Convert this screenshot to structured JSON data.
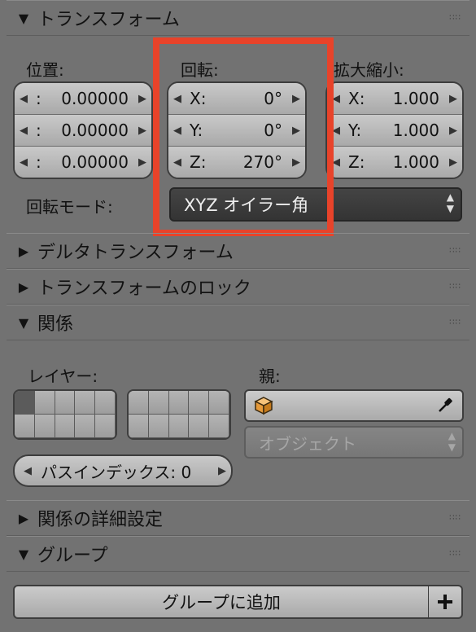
{
  "transform": {
    "header": "トランスフォーム",
    "location": {
      "label": "位置:",
      "rows": [
        {
          "axis": ":",
          "value": "0.00000"
        },
        {
          "axis": ":",
          "value": "0.00000"
        },
        {
          "axis": ":",
          "value": "0.00000"
        }
      ]
    },
    "rotation": {
      "label": "回転:",
      "rows": [
        {
          "axis": "X:",
          "value": "0°"
        },
        {
          "axis": "Y:",
          "value": "0°"
        },
        {
          "axis": "Z:",
          "value": "270°"
        }
      ]
    },
    "scale": {
      "label": "拡大縮小:",
      "rows": [
        {
          "axis": "X:",
          "value": "1.000"
        },
        {
          "axis": "Y:",
          "value": "1.000"
        },
        {
          "axis": "Z:",
          "value": "1.000"
        }
      ]
    },
    "rotation_mode_label": "回転モード:",
    "rotation_mode_value": "XYZ オイラー角"
  },
  "delta_transform": {
    "header": "デルタトランスフォーム"
  },
  "transform_locks": {
    "header": "トランスフォームのロック"
  },
  "relations": {
    "header": "関係",
    "layer_label": "レイヤー:",
    "parent_label": "親:",
    "parent_type_value": "オブジェクト",
    "pass_index": "パスインデックス: 0"
  },
  "relations_extras": {
    "header": "関係の詳細設定"
  },
  "groups": {
    "header": "グループ",
    "add_label": "グループに追加"
  },
  "colors": {
    "highlight": "#e8432a",
    "panel_bg": "#727272"
  }
}
